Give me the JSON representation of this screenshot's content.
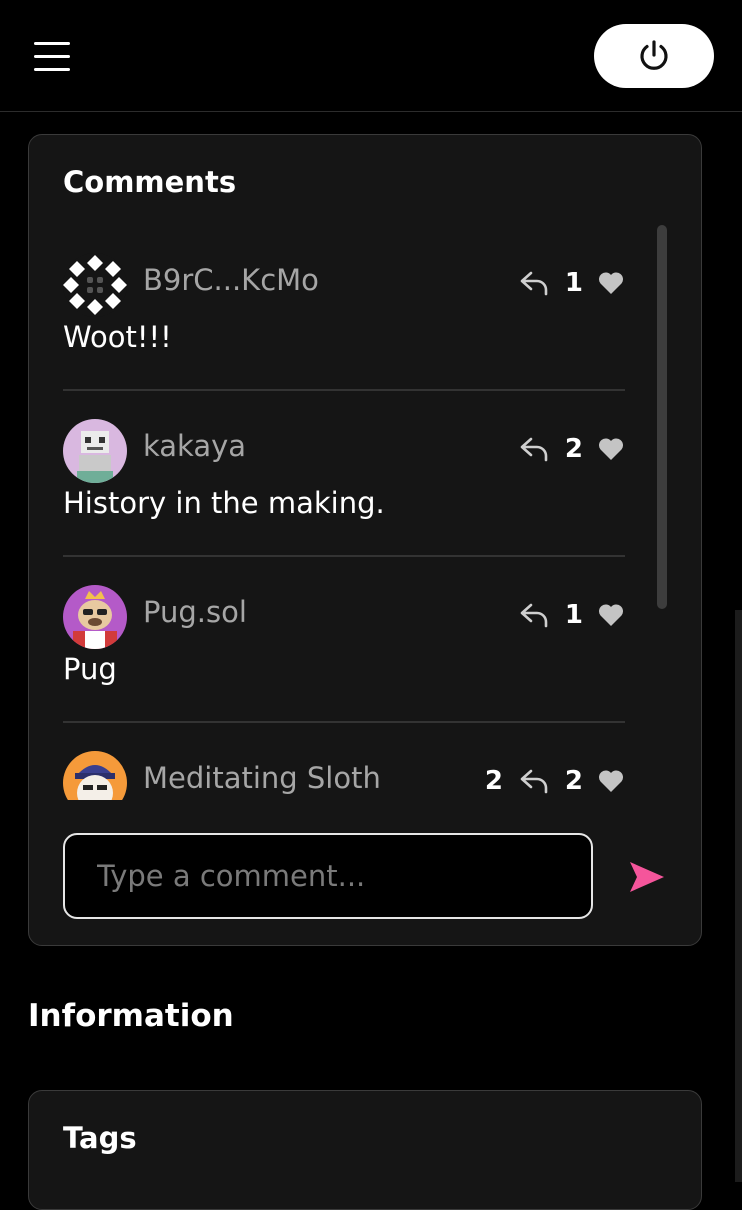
{
  "comments_section": {
    "title": "Comments",
    "items": [
      {
        "username": "B9rC...KcMo",
        "text": "Woot!!!",
        "reply_count": "",
        "like_count": "1"
      },
      {
        "username": "kakaya",
        "text": "History in the making.",
        "reply_count": "",
        "like_count": "2"
      },
      {
        "username": "Pug.sol",
        "text": "Pug",
        "reply_count": "",
        "like_count": "1"
      },
      {
        "username": "Meditating Sloth",
        "text": "",
        "reply_count": "2",
        "like_count": "2"
      }
    ],
    "input_placeholder": "Type a comment..."
  },
  "information": {
    "title": "Information"
  },
  "tags": {
    "title": "Tags"
  },
  "colors": {
    "accent_send": "#f5559b",
    "background": "#000000",
    "card": "#151515"
  }
}
